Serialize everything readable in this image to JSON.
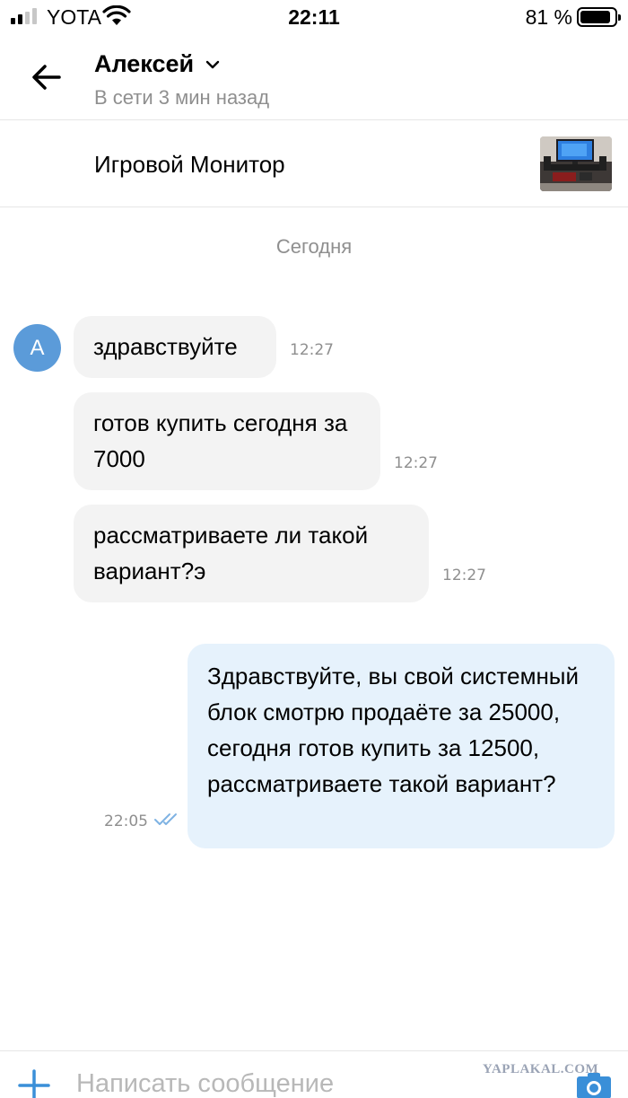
{
  "status_bar": {
    "carrier": "YOTA",
    "time": "22:11",
    "battery_percent": "81 %",
    "battery_level": 0.81,
    "signal_bars": 2
  },
  "header": {
    "contact_name": "Алексей",
    "contact_status": "В сети 3 мин назад"
  },
  "ad": {
    "title": "Игровой Монитор"
  },
  "chat": {
    "date_divider": "Сегодня",
    "avatar_letter": "A",
    "messages": [
      {
        "direction": "in",
        "text": "здравствуйте",
        "time": "12:27"
      },
      {
        "direction": "in",
        "text": "готов купить сегодня за 7000",
        "time": "12:27"
      },
      {
        "direction": "in",
        "text": "рассматриваете ли такой вариант?э",
        "time": "12:27"
      },
      {
        "direction": "out",
        "text": "Здравствуйте, вы свой системный блок смотрю продаёте за 25000, сегодня готов купить за 12500, рассматриваете такой вариант?",
        "time": "22:05",
        "status": "read"
      }
    ]
  },
  "composer": {
    "placeholder": "Написать сообщение"
  },
  "watermark": "YAPLAKAL.COM",
  "colors": {
    "accent": "#3a8fd8",
    "incoming_bubble": "#f3f3f3",
    "outgoing_bubble": "#e6f2fc",
    "avatar": "#5b9bd9",
    "muted_text": "#8f8f8f"
  }
}
